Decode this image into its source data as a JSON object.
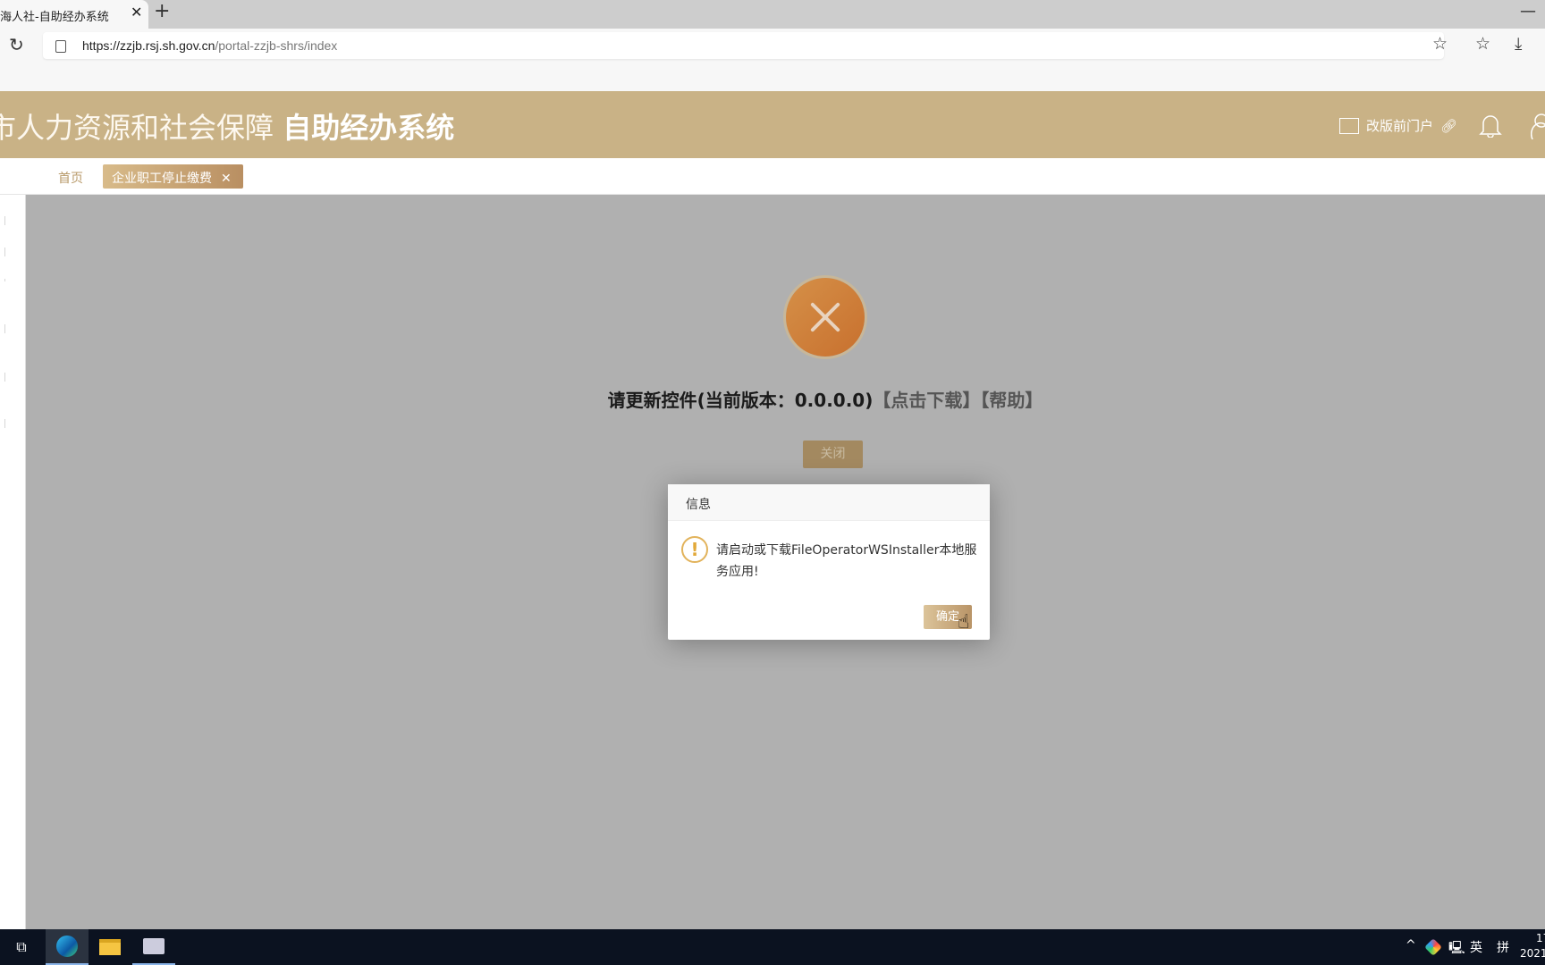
{
  "browser": {
    "tab_title": "海人社-自助经办系统",
    "url_host": "https://zzjb.rsj.sh.gov.cn",
    "url_path": "/portal-zzjb-shrs/index"
  },
  "header": {
    "title_regular": "市人力资源和社会保障 ",
    "title_bold": "自助经办系统",
    "portal_link": "改版前门户",
    "brand_color": "#c9b286"
  },
  "nav": {
    "home": "首页",
    "active_tab": "企业职工停止缴费"
  },
  "error_panel": {
    "message_prefix": "请更新控件(当前版本：0.0.0.0)",
    "download_link": "【点击下载】",
    "help_link": "【帮助】",
    "close_button": "关闭",
    "icon": "error-x-icon"
  },
  "dialog": {
    "title": "信息",
    "message": "请启动或下载FileOperatorWSInstaller本地服务应用!",
    "ok_button": "确定",
    "icon": "warning-icon"
  },
  "taskbar": {
    "ime_lang": "英",
    "ime_mode": "拼",
    "clock_time": "17",
    "clock_date": "2021"
  }
}
